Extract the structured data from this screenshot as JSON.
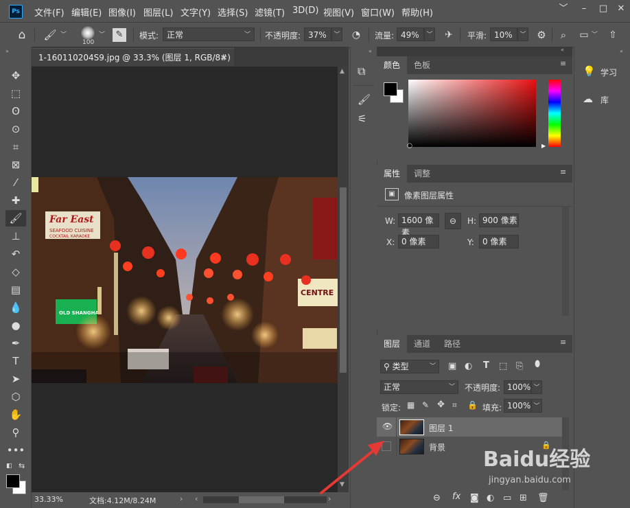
{
  "menubar": {
    "logo": "Ps",
    "items": [
      "文件(F)",
      "编辑(E)",
      "图像(I)",
      "图层(L)",
      "文字(Y)",
      "选择(S)",
      "滤镜(T)",
      "3D(D)",
      "视图(V)",
      "窗口(W)",
      "帮助(H)"
    ],
    "window_buttons": [
      "﹀",
      "–",
      "□",
      "✕"
    ]
  },
  "options": {
    "brush_size": "100",
    "mode_label": "模式:",
    "mode_value": "正常",
    "opacity_label": "不透明度:",
    "opacity_value": "37%",
    "flow_label": "流量:",
    "flow_value": "49%",
    "smooth_label": "平滑:",
    "smooth_value": "10%"
  },
  "document": {
    "tab_title": "1-160110204S9.jpg @ 33.3% (图层 1, RGB/8#) *",
    "zoom": "33.33%",
    "doc_size": "文档:4.12M/8.24M"
  },
  "color_panel": {
    "tabs": [
      "颜色",
      "色板"
    ]
  },
  "properties_panel": {
    "tabs": [
      "属性",
      "调整"
    ],
    "title": "像素图层属性",
    "w_label": "W:",
    "w_value": "1600 像素",
    "h_label": "H:",
    "h_value": "900 像素",
    "x_label": "X:",
    "x_value": "0 像素",
    "y_label": "Y:",
    "y_value": "0 像素"
  },
  "layers_panel": {
    "tabs": [
      "图层",
      "通道",
      "路径"
    ],
    "filter_label": "类型",
    "blend_mode": "正常",
    "opacity_label": "不透明度:",
    "opacity_value": "100%",
    "lock_label": "锁定:",
    "fill_label": "填充:",
    "fill_value": "100%",
    "layers": [
      {
        "name": "图层 1",
        "visible": true,
        "selected": true
      },
      {
        "name": "背景",
        "visible": false,
        "selected": false,
        "locked": true
      }
    ],
    "footer_fx": "fx"
  },
  "right_panel": {
    "items": [
      {
        "label": "学习",
        "icon": "lightbulb-icon"
      },
      {
        "label": "库",
        "icon": "cloud-library-icon"
      }
    ]
  },
  "watermark": {
    "brand": "Baidu经验",
    "url": "jingyan.baidu.com"
  },
  "colors": {
    "foreground": "#000000",
    "background": "#ffffff",
    "accent_arrow": "#e53935"
  }
}
